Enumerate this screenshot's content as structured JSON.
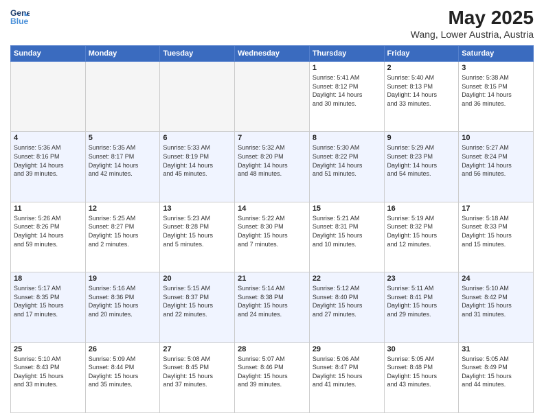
{
  "header": {
    "logo_line1": "General",
    "logo_line2": "Blue",
    "main_title": "May 2025",
    "subtitle": "Wang, Lower Austria, Austria"
  },
  "days_of_week": [
    "Sunday",
    "Monday",
    "Tuesday",
    "Wednesday",
    "Thursday",
    "Friday",
    "Saturday"
  ],
  "weeks": [
    [
      {
        "num": "",
        "info": ""
      },
      {
        "num": "",
        "info": ""
      },
      {
        "num": "",
        "info": ""
      },
      {
        "num": "",
        "info": ""
      },
      {
        "num": "1",
        "info": "Sunrise: 5:41 AM\nSunset: 8:12 PM\nDaylight: 14 hours\nand 30 minutes."
      },
      {
        "num": "2",
        "info": "Sunrise: 5:40 AM\nSunset: 8:13 PM\nDaylight: 14 hours\nand 33 minutes."
      },
      {
        "num": "3",
        "info": "Sunrise: 5:38 AM\nSunset: 8:15 PM\nDaylight: 14 hours\nand 36 minutes."
      }
    ],
    [
      {
        "num": "4",
        "info": "Sunrise: 5:36 AM\nSunset: 8:16 PM\nDaylight: 14 hours\nand 39 minutes."
      },
      {
        "num": "5",
        "info": "Sunrise: 5:35 AM\nSunset: 8:17 PM\nDaylight: 14 hours\nand 42 minutes."
      },
      {
        "num": "6",
        "info": "Sunrise: 5:33 AM\nSunset: 8:19 PM\nDaylight: 14 hours\nand 45 minutes."
      },
      {
        "num": "7",
        "info": "Sunrise: 5:32 AM\nSunset: 8:20 PM\nDaylight: 14 hours\nand 48 minutes."
      },
      {
        "num": "8",
        "info": "Sunrise: 5:30 AM\nSunset: 8:22 PM\nDaylight: 14 hours\nand 51 minutes."
      },
      {
        "num": "9",
        "info": "Sunrise: 5:29 AM\nSunset: 8:23 PM\nDaylight: 14 hours\nand 54 minutes."
      },
      {
        "num": "10",
        "info": "Sunrise: 5:27 AM\nSunset: 8:24 PM\nDaylight: 14 hours\nand 56 minutes."
      }
    ],
    [
      {
        "num": "11",
        "info": "Sunrise: 5:26 AM\nSunset: 8:26 PM\nDaylight: 14 hours\nand 59 minutes."
      },
      {
        "num": "12",
        "info": "Sunrise: 5:25 AM\nSunset: 8:27 PM\nDaylight: 15 hours\nand 2 minutes."
      },
      {
        "num": "13",
        "info": "Sunrise: 5:23 AM\nSunset: 8:28 PM\nDaylight: 15 hours\nand 5 minutes."
      },
      {
        "num": "14",
        "info": "Sunrise: 5:22 AM\nSunset: 8:30 PM\nDaylight: 15 hours\nand 7 minutes."
      },
      {
        "num": "15",
        "info": "Sunrise: 5:21 AM\nSunset: 8:31 PM\nDaylight: 15 hours\nand 10 minutes."
      },
      {
        "num": "16",
        "info": "Sunrise: 5:19 AM\nSunset: 8:32 PM\nDaylight: 15 hours\nand 12 minutes."
      },
      {
        "num": "17",
        "info": "Sunrise: 5:18 AM\nSunset: 8:33 PM\nDaylight: 15 hours\nand 15 minutes."
      }
    ],
    [
      {
        "num": "18",
        "info": "Sunrise: 5:17 AM\nSunset: 8:35 PM\nDaylight: 15 hours\nand 17 minutes."
      },
      {
        "num": "19",
        "info": "Sunrise: 5:16 AM\nSunset: 8:36 PM\nDaylight: 15 hours\nand 20 minutes."
      },
      {
        "num": "20",
        "info": "Sunrise: 5:15 AM\nSunset: 8:37 PM\nDaylight: 15 hours\nand 22 minutes."
      },
      {
        "num": "21",
        "info": "Sunrise: 5:14 AM\nSunset: 8:38 PM\nDaylight: 15 hours\nand 24 minutes."
      },
      {
        "num": "22",
        "info": "Sunrise: 5:12 AM\nSunset: 8:40 PM\nDaylight: 15 hours\nand 27 minutes."
      },
      {
        "num": "23",
        "info": "Sunrise: 5:11 AM\nSunset: 8:41 PM\nDaylight: 15 hours\nand 29 minutes."
      },
      {
        "num": "24",
        "info": "Sunrise: 5:10 AM\nSunset: 8:42 PM\nDaylight: 15 hours\nand 31 minutes."
      }
    ],
    [
      {
        "num": "25",
        "info": "Sunrise: 5:10 AM\nSunset: 8:43 PM\nDaylight: 15 hours\nand 33 minutes."
      },
      {
        "num": "26",
        "info": "Sunrise: 5:09 AM\nSunset: 8:44 PM\nDaylight: 15 hours\nand 35 minutes."
      },
      {
        "num": "27",
        "info": "Sunrise: 5:08 AM\nSunset: 8:45 PM\nDaylight: 15 hours\nand 37 minutes."
      },
      {
        "num": "28",
        "info": "Sunrise: 5:07 AM\nSunset: 8:46 PM\nDaylight: 15 hours\nand 39 minutes."
      },
      {
        "num": "29",
        "info": "Sunrise: 5:06 AM\nSunset: 8:47 PM\nDaylight: 15 hours\nand 41 minutes."
      },
      {
        "num": "30",
        "info": "Sunrise: 5:05 AM\nSunset: 8:48 PM\nDaylight: 15 hours\nand 43 minutes."
      },
      {
        "num": "31",
        "info": "Sunrise: 5:05 AM\nSunset: 8:49 PM\nDaylight: 15 hours\nand 44 minutes."
      }
    ]
  ]
}
